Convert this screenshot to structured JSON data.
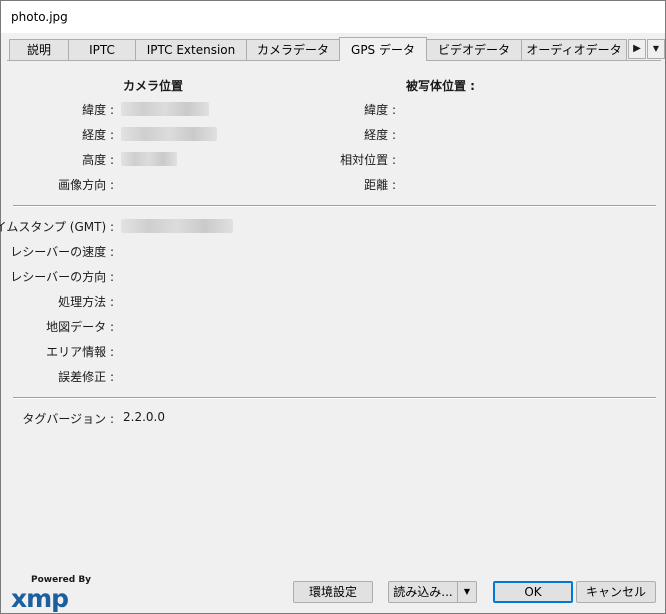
{
  "window": {
    "title": "photo.jpg"
  },
  "tabs": [
    {
      "label": "説明"
    },
    {
      "label": "IPTC"
    },
    {
      "label": "IPTC Extension"
    },
    {
      "label": "カメラデータ"
    },
    {
      "label": "GPS データ"
    },
    {
      "label": "ビデオデータ"
    },
    {
      "label": "オーディオデータ"
    }
  ],
  "tab_scroll": {
    "next": "▶",
    "menu": "▼"
  },
  "camera_position": {
    "heading": "カメラ位置",
    "latitude_label": "緯度 :",
    "longitude_label": "経度 :",
    "altitude_label": "高度 :",
    "direction_label": "画像方向 :"
  },
  "subject_position": {
    "heading": "被写体位置 :",
    "latitude_label": "緯度 :",
    "longitude_label": "経度 :",
    "relative_label": "相対位置 :",
    "distance_label": "距離 :"
  },
  "details": {
    "timestamp_label": "タイムスタンプ (GMT) :",
    "receiver_speed_label": "レシーバーの速度 :",
    "receiver_direction_label": "レシーバーの方向 :",
    "processing_method_label": "処理方法 :",
    "map_datum_label": "地図データ :",
    "area_info_label": "エリア情報 :",
    "error_correction_label": "誤差修正 :"
  },
  "tag_version": {
    "label": "タグバージョン :",
    "value": "2.2.0.0"
  },
  "footer": {
    "powered_by": "Powered By",
    "logo": "xmp",
    "preferences_button": "環境設定",
    "import_button": "読み込み...",
    "import_dropdown": "▼",
    "ok_button": "OK",
    "cancel_button": "キャンセル"
  }
}
